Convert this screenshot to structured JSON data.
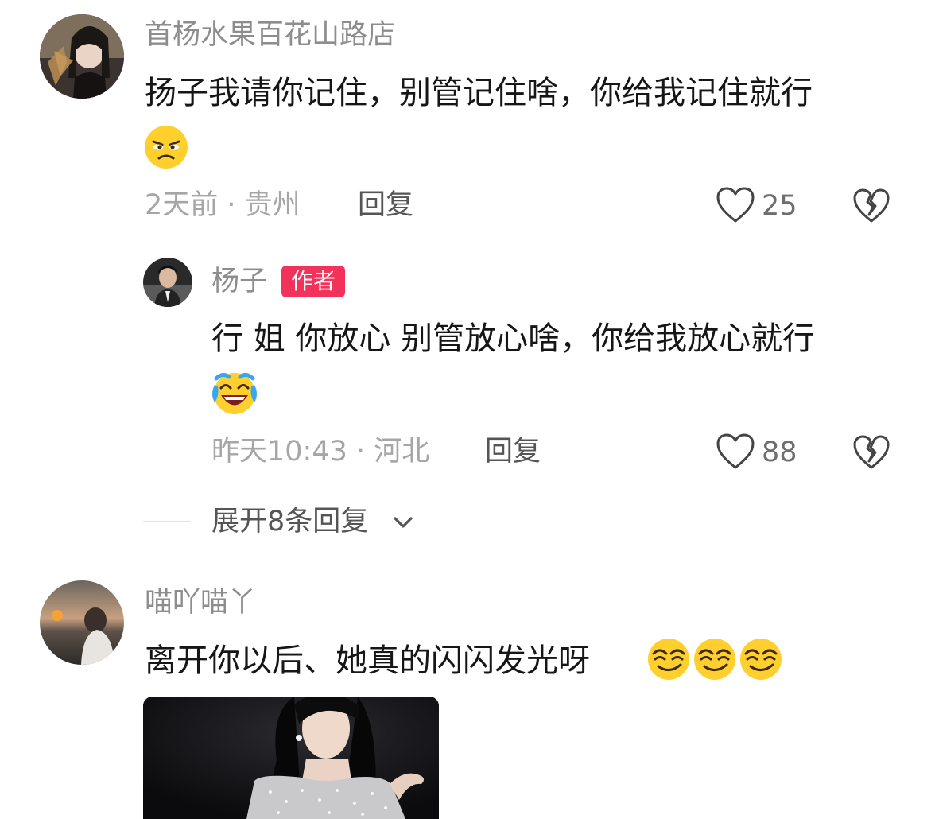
{
  "comments": [
    {
      "username": "首杨水果百花山路店",
      "text": "扬子我请你记住，别管记住啥，你给我记住就行",
      "emoji": "glare-face-emoji",
      "meta": "2天前 · 贵州",
      "reply_label": "回复",
      "likes": "25",
      "replies": [
        {
          "username": "杨子",
          "badge": "作者",
          "text": "行 姐 你放心 别管放心啥，你给我放心就行",
          "emoji": "laughing-tears-emoji",
          "meta": "昨天10:43 · 河北",
          "reply_label": "回复",
          "likes": "88"
        }
      ],
      "expand_label": "展开8条回复"
    },
    {
      "username": "喵吖喵丫",
      "text": "离开你以后、她真的闪闪发光呀",
      "emoji": "smirk-face-emoji",
      "emoji_count": 3
    }
  ],
  "colors": {
    "badge": "#f2325a",
    "emoji_yellow": "#ffcf2e",
    "username": "#8d8d8d",
    "meta": "#a6a6a6"
  },
  "icons": [
    "heart-outline-icon",
    "broken-heart-icon",
    "chevron-down-icon"
  ]
}
